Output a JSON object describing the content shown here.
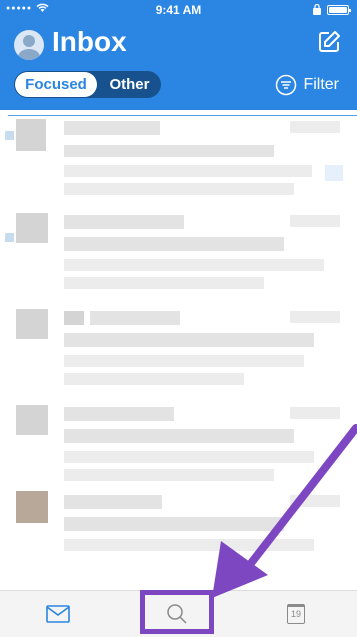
{
  "status_bar": {
    "time": "9:41 AM"
  },
  "header": {
    "title": "Inbox",
    "tabs": [
      "Focused",
      "Other"
    ],
    "filter_label": "Filter"
  },
  "tab_bar": {
    "items": [
      {
        "icon": "mail-icon"
      },
      {
        "icon": "search-icon"
      },
      {
        "icon": "calendar-icon",
        "label": "19"
      }
    ]
  },
  "annotation": {
    "color": "#7e47c2"
  },
  "colors": {
    "brand": "#2a86e2"
  }
}
